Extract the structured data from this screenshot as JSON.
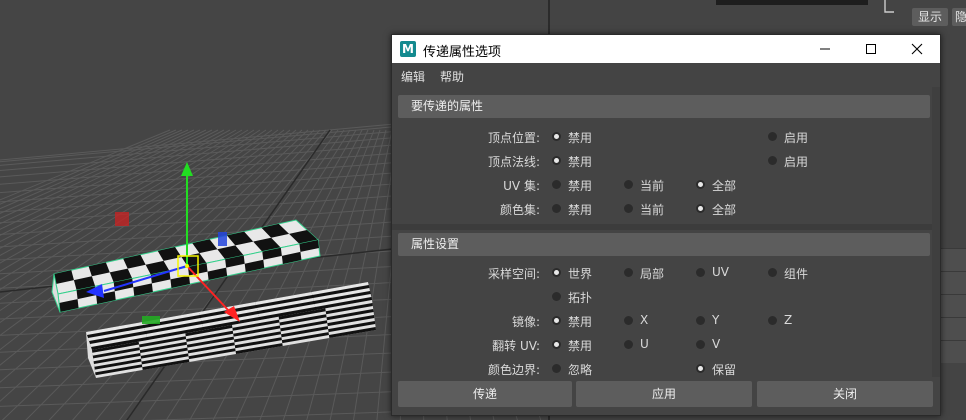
{
  "viewport": {
    "label": "3d-viewport"
  },
  "right_panel": {
    "display_button": "显示",
    "hide_button": "隐藏"
  },
  "dialog": {
    "title": "传递属性选项",
    "app_logo": "M",
    "window_controls": {
      "minimize": "minimize-icon",
      "maximize": "maximize-icon",
      "close": "close-icon"
    },
    "menu": [
      "编辑",
      "帮助"
    ],
    "sections": [
      {
        "title": "要传递的属性",
        "rows": [
          {
            "label": "顶点位置:",
            "options": [
              {
                "text": "禁用",
                "checked": true
              },
              {
                "text": "启用",
                "checked": false
              }
            ]
          },
          {
            "label": "顶点法线:",
            "options": [
              {
                "text": "禁用",
                "checked": true
              },
              {
                "text": "启用",
                "checked": false
              }
            ]
          },
          {
            "label": "UV 集:",
            "options": [
              {
                "text": "禁用",
                "checked": false
              },
              {
                "text": "当前",
                "checked": false
              },
              {
                "text": "全部",
                "checked": true
              }
            ]
          },
          {
            "label": "颜色集:",
            "options": [
              {
                "text": "禁用",
                "checked": false
              },
              {
                "text": "当前",
                "checked": false
              },
              {
                "text": "全部",
                "checked": true
              }
            ]
          }
        ]
      },
      {
        "title": "属性设置",
        "rows": [
          {
            "label": "采样空间:",
            "options": [
              {
                "text": "世界",
                "checked": true
              },
              {
                "text": "局部",
                "checked": false
              },
              {
                "text": "UV",
                "checked": false
              },
              {
                "text": "组件",
                "checked": false
              }
            ]
          },
          {
            "label": "",
            "options": [
              {
                "text": "拓扑",
                "checked": false
              }
            ]
          },
          {
            "label": "镜像:",
            "options": [
              {
                "text": "禁用",
                "checked": true
              },
              {
                "text": "X",
                "checked": false
              },
              {
                "text": "Y",
                "checked": false
              },
              {
                "text": "Z",
                "checked": false
              }
            ]
          },
          {
            "label": "翻转 UV:",
            "options": [
              {
                "text": "禁用",
                "checked": true
              },
              {
                "text": "U",
                "checked": false
              },
              {
                "text": "V",
                "checked": false
              }
            ]
          },
          {
            "label": "颜色边界:",
            "options": [
              {
                "text": "忽略",
                "checked": false
              },
              {
                "text": "保留",
                "checked": true
              }
            ]
          }
        ]
      }
    ],
    "buttons": {
      "transfer": "传递",
      "apply": "应用",
      "close": "关闭"
    }
  }
}
